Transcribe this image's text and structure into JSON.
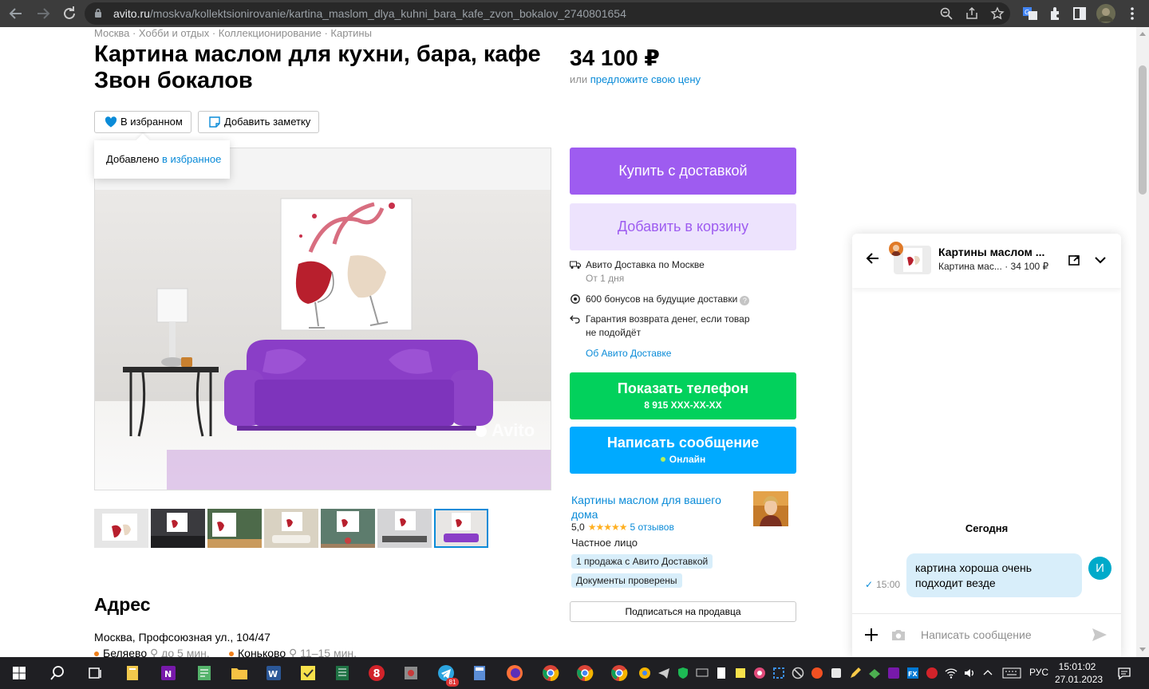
{
  "browser": {
    "url_host": "avito.ru",
    "url_path": "/moskva/kollektsionirovanie/kartina_maslom_dlya_kuhni_bara_kafe_zvon_bokalov_2740801654"
  },
  "breadcrumbs": "Москва · Хобби и отдых · Коллекционирование · Картины",
  "listing": {
    "title": "Картина маслом для кухни, бара, кафе Звон бокалов",
    "price": "34 100 ₽",
    "offer_prefix": "или ",
    "offer_link": "предложите свою цену",
    "favorite_label": "В избранном",
    "note_label": "Добавить заметку",
    "tooltip_prefix": "Добавлено ",
    "tooltip_link": "в избранное",
    "watermark": "Avito"
  },
  "actions": {
    "buy": "Купить с доставкой",
    "cart": "Добавить в корзину",
    "phone": "Показать телефон",
    "phone_number": "8 915 XXX-XX-XX",
    "message": "Написать сообщение",
    "online": "Онлайн",
    "subscribe": "Подписаться на продавца"
  },
  "delivery": {
    "line1": "Авито Доставка по Москве",
    "line1_sub": "От 1 дня",
    "bonus": "600 бонусов на будущие доставки",
    "guarantee_1": "Гарантия возврата денег, если товар",
    "guarantee_2": "не подойдёт",
    "link": "Об Авито Доставке"
  },
  "seller": {
    "name": "Картины маслом для вашего дома",
    "rating": "5,0",
    "stars": "★★★★★",
    "reviews": "5 отзывов",
    "type": "Частное лицо",
    "tag1": "1 продажа с Авито Доставкой",
    "tag2": "Документы проверены"
  },
  "address": {
    "heading": "Адрес",
    "line": "Москва, Профсоюзная ул., 104/47",
    "metro": [
      {
        "station": "Беляево",
        "walk": "до 5 мин."
      },
      {
        "station": "Коньково",
        "walk": "11–15 мин."
      }
    ]
  },
  "chat": {
    "title": "Картины маслом ...",
    "subtitle_item": "Картина мас...",
    "subtitle_price": "· 34 100 ₽",
    "date_divider": "Сегодня",
    "message_text": "картина хороша очень подходит везде",
    "message_time": "15:00",
    "avatar_letter": "И",
    "input_placeholder": "Написать сообщение"
  },
  "taskbar": {
    "lang": "РУС",
    "time": "15:01:02",
    "date": "27.01.2023",
    "telegram_badge": "81"
  },
  "colors": {
    "buy": "#9e5cf0",
    "cart": "#ede3fd",
    "phone": "#02d15c",
    "message": "#00aaff",
    "link": "#0a8bd8"
  }
}
